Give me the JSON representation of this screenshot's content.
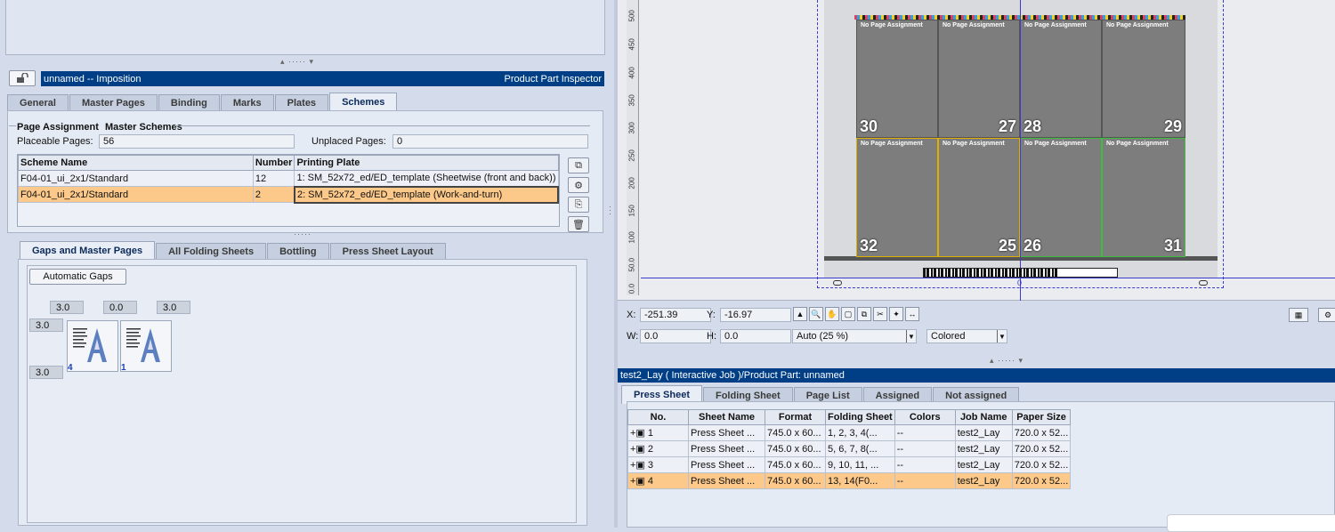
{
  "imposition": {
    "title": "unnamed -- Imposition",
    "inspector_label": "Product Part Inspector",
    "tabs": [
      "General",
      "Master Pages",
      "Binding",
      "Marks",
      "Plates",
      "Schemes"
    ],
    "active_tab": "Schemes",
    "page_assignment_label": "Page Assignment",
    "master_schemes_label": "Master Schemes",
    "placeable_label": "Placeable Pages:",
    "placeable_value": "56",
    "unplaced_label": "Unplaced Pages:",
    "unplaced_value": "0",
    "scheme_table": {
      "headers": [
        "Scheme Name",
        "Number",
        "Printing Plate"
      ],
      "rows": [
        {
          "name": "F04-01_ui_2x1/Standard",
          "number": "12",
          "plate": "1: SM_52x72_ed/ED_template (Sheetwise (front and back))"
        },
        {
          "name": "F04-01_ui_2x1/Standard",
          "number": "2",
          "plate": "2: SM_52x72_ed/ED_template (Work-and-turn)"
        }
      ]
    },
    "sub_tabs": [
      "Gaps and Master Pages",
      "All Folding Sheets",
      "Bottling",
      "Press Sheet Layout"
    ],
    "automatic_gaps_label": "Automatic Gaps",
    "gaps_top": [
      "3.0",
      "0.0",
      "3.0"
    ],
    "gaps_side": [
      "3.0",
      "3.0"
    ],
    "thumbs": [
      {
        "label": "4"
      },
      {
        "label": "1"
      }
    ]
  },
  "canvas": {
    "ruler_ticks": [
      "500",
      "450",
      "400",
      "350",
      "300",
      "250",
      "200",
      "150",
      "100",
      "50.0",
      "0.0"
    ],
    "pages_top": [
      {
        "label": "No Page Assignment",
        "number": "30"
      },
      {
        "label": "No Page Assignment",
        "number": "27"
      },
      {
        "label": "No Page Assignment",
        "number": "28"
      },
      {
        "label": "No Page Assignment",
        "number": "29"
      }
    ],
    "pages_bottom": [
      {
        "label": "No Page Assignment",
        "number": "32"
      },
      {
        "label": "No Page Assignment",
        "number": "25"
      },
      {
        "label": "No Page Assignment",
        "number": "26"
      },
      {
        "label": "No Page Assignment",
        "number": "31"
      }
    ],
    "origin_label": "0"
  },
  "coords": {
    "x_label": "X:",
    "x_value": "-251.39",
    "y_label": "Y:",
    "y_value": "-16.97",
    "w_label": "W:",
    "w_value": "0.0",
    "h_label": "H:",
    "h_value": "0.0",
    "zoom_value": "Auto (25 %)",
    "color_mode": "Colored"
  },
  "job": {
    "title": "test2_Lay ( Interactive Job )/Product Part: unnamed",
    "tabs": [
      "Press Sheet",
      "Folding Sheet",
      "Page List",
      "Assigned",
      "Not assigned"
    ],
    "active_tab": "Press Sheet",
    "headers": [
      "No.",
      "Sheet Name",
      "Format",
      "Folding Sheet",
      "Colors",
      "Job Name",
      "Paper Size"
    ],
    "rows": [
      {
        "no": "1",
        "sheet": "Press Sheet ...",
        "format": "745.0 x 60...",
        "folding": "1, 2, 3, 4(...",
        "colors": "--",
        "job": "test2_Lay",
        "paper": "720.0 x 52..."
      },
      {
        "no": "2",
        "sheet": "Press Sheet ...",
        "format": "745.0 x 60...",
        "folding": "5, 6, 7, 8(...",
        "colors": "--",
        "job": "test2_Lay",
        "paper": "720.0 x 52..."
      },
      {
        "no": "3",
        "sheet": "Press Sheet ...",
        "format": "745.0 x 60...",
        "folding": "9, 10, 11, ...",
        "colors": "--",
        "job": "test2_Lay",
        "paper": "720.0 x 52..."
      },
      {
        "no": "4",
        "sheet": "Press Sheet ...",
        "format": "745.0 x 60...",
        "folding": "13, 14(F0...",
        "colors": "--",
        "job": "test2_Lay",
        "paper": "720.0 x 52..."
      }
    ],
    "selected_row": 3
  },
  "colors": {
    "title_bar": "#003f86",
    "selection": "#fcc98a",
    "sheet_outline": "#3b3bcf",
    "page_fill": "#7d7d7d"
  }
}
